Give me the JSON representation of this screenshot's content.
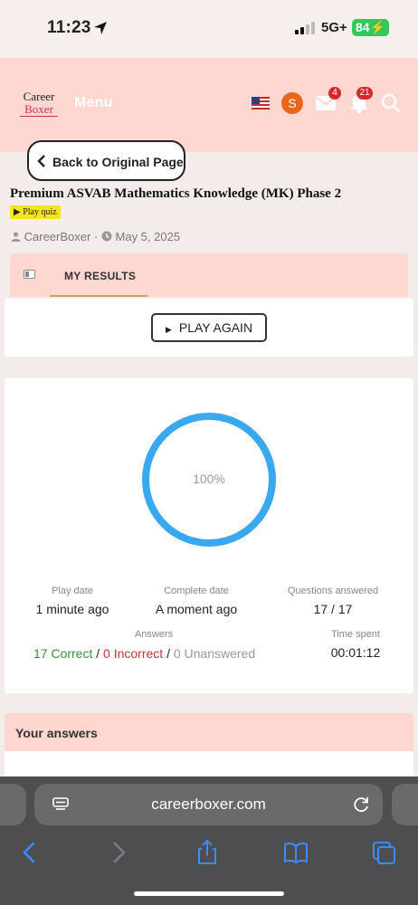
{
  "status_bar": {
    "time": "11:23",
    "network": "5G+",
    "battery": "84"
  },
  "header": {
    "logo_line1": "Career",
    "logo_line2": "Boxer",
    "menu_label": "Menu",
    "avatar_letter": "S",
    "mail_badge": "4",
    "bell_badge": "21"
  },
  "back_button": {
    "label": "Back to Original Page"
  },
  "quiz": {
    "title": "Premium ASVAB Mathematics Knowledge (MK) Phase 2",
    "tag": "Play quiz",
    "author": "CareerBoxer",
    "date": "May 5, 2025"
  },
  "tabs": {
    "active_label": "MY RESULTS"
  },
  "results": {
    "play_again_label": "PLAY AGAIN",
    "percent": "100%",
    "percent_value": 100,
    "play_date_label": "Play date",
    "play_date_value": "1 minute ago",
    "complete_date_label": "Complete date",
    "complete_date_value": "A moment ago",
    "questions_label": "Questions answered",
    "questions_value": "17 / 17",
    "answers_label": "Answers",
    "correct": "17 Correct",
    "incorrect": "0 Incorrect",
    "unanswered": "0 Unanswered",
    "separator": "/",
    "time_spent_label": "Time spent",
    "time_spent_value": "00:01:12"
  },
  "your_answers": {
    "title": "Your answers"
  },
  "browser": {
    "url": "careerboxer.com"
  },
  "colors": {
    "header_bg": "#fdd7d0",
    "ring": "#3aa8ef",
    "correct": "#3c8b3c",
    "incorrect": "#c43535"
  }
}
